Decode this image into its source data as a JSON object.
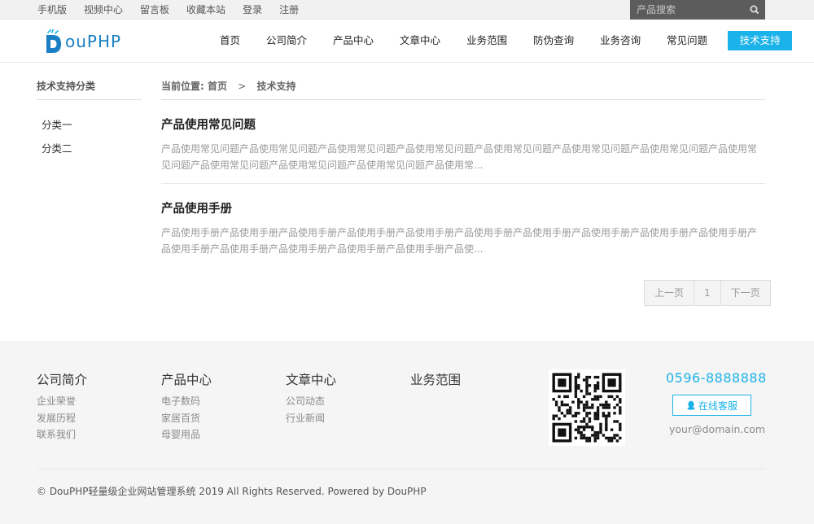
{
  "topbar": {
    "links": [
      "手机版",
      "视频中心",
      "留言板",
      "收藏本站",
      "登录",
      "注册"
    ],
    "search_placeholder": "产品搜索",
    "search_bg": "#5c5c5c"
  },
  "header": {
    "logo_text": "ouPHP",
    "logo_letter": "D",
    "nav": [
      "首页",
      "公司简介",
      "产品中心",
      "文章中心",
      "业务范围",
      "防伪查询",
      "业务咨询",
      "常见问题"
    ],
    "nav_active": "技术支持",
    "accent": "#1ab2e8"
  },
  "sidebar": {
    "title": "技术支持分类",
    "items": [
      "分类一",
      "分类二"
    ]
  },
  "breadcrumb": {
    "prefix": "当前位置:",
    "home": "首页",
    "separator": ">",
    "current": "技术支持"
  },
  "articles": [
    {
      "title": "产品使用常见问题",
      "desc": "产品使用常见问题产品使用常见问题产品使用常见问题产品使用常见问题产品使用常见问题产品使用常见问题产品使用常见问题产品使用常见问题产品使用常见问题产品使用常见问题产品使用常见问题产品使用常..."
    },
    {
      "title": "产品使用手册",
      "desc": "产品使用手册产品使用手册产品使用手册产品使用手册产品使用手册产品使用手册产品使用手册产品使用手册产品使用手册产品使用手册产品使用手册产品使用手册产品使用手册产品使用手册产品使用手册产品使..."
    }
  ],
  "pager": {
    "prev": "上一页",
    "page": "1",
    "next": "下一页"
  },
  "footer": {
    "cols": [
      {
        "title": "公司简介",
        "links": [
          "企业荣誉",
          "发展历程",
          "联系我们"
        ]
      },
      {
        "title": "产品中心",
        "links": [
          "电子数码",
          "家居百货",
          "母婴用品"
        ]
      },
      {
        "title": "文章中心",
        "links": [
          "公司动态",
          "行业新闻"
        ]
      },
      {
        "title": "业务范围",
        "links": []
      }
    ],
    "phone": "0596-8888888",
    "service_label": "在线客服",
    "email": "your@domain.com",
    "copyright": "© DouPHP轻量级企业网站管理系统 2019 All Rights Reserved. Powered by DouPHP"
  }
}
